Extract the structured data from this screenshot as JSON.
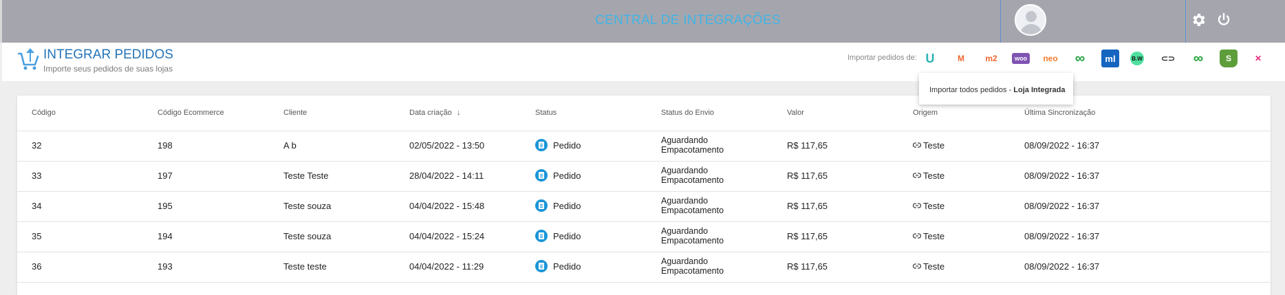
{
  "topbar": {
    "title": "CENTRAL DE INTEGRAÇÕES",
    "icons": [
      "avatar",
      "gear-icon",
      "power-icon"
    ]
  },
  "page": {
    "title": "INTEGRAR PEDIDOS",
    "subtitle": "Importe seus pedidos de suas lojas",
    "import_label": "Importar pedidos de:"
  },
  "stores": [
    {
      "name": "loja-integrada",
      "glyph": "U",
      "color": "#2bb5b0"
    },
    {
      "name": "magento",
      "glyph": "M",
      "color": "#ee672f"
    },
    {
      "name": "magento-2",
      "glyph": "m2",
      "color": "#ee672f"
    },
    {
      "name": "woocommerce",
      "glyph": "woo",
      "color": "#7f54b3"
    },
    {
      "name": "neo",
      "glyph": "neo",
      "color": "#f07b2c"
    },
    {
      "name": "tray",
      "glyph": "∞",
      "color": "#1fa339"
    },
    {
      "name": "mercado-livre",
      "glyph": "ml",
      "color": "#1565c0"
    },
    {
      "name": "bw",
      "glyph": "B.W",
      "color": "#1f8f44"
    },
    {
      "name": "link-store",
      "glyph": "⊂⊃",
      "color": "#333333"
    },
    {
      "name": "tray-2",
      "glyph": "∞",
      "color": "#1fa339"
    },
    {
      "name": "shopify",
      "glyph": "S",
      "color": "#5e9e3a"
    },
    {
      "name": "vtex-like",
      "glyph": "✕",
      "color": "#e6297a"
    }
  ],
  "tooltip": {
    "prefix": "Importar todos pedidos - ",
    "store": "Loja Integrada"
  },
  "table": {
    "columns": [
      "Código",
      "Código Ecommerce",
      "Cliente",
      "Data criação",
      "Status",
      "Status do Envio",
      "Valor",
      "Origem",
      "Última Sincronização"
    ],
    "sort_indicator": "↓",
    "rows": [
      {
        "codigo": "32",
        "ecommerce": "198",
        "cliente": "A b",
        "data": "02/05/2022 - 13:50",
        "status": "Pedido",
        "envio1": "Aguardando",
        "envio2": "Empacotamento",
        "valor": "R$ 117,65",
        "origem": "Teste",
        "sync": "08/09/2022 - 16:37"
      },
      {
        "codigo": "33",
        "ecommerce": "197",
        "cliente": "Teste Teste",
        "data": "28/04/2022 - 14:11",
        "status": "Pedido",
        "envio1": "Aguardando",
        "envio2": "Empacotamento",
        "valor": "R$ 117,65",
        "origem": "Teste",
        "sync": "08/09/2022 - 16:37"
      },
      {
        "codigo": "34",
        "ecommerce": "195",
        "cliente": "Teste souza",
        "data": "04/04/2022 - 15:48",
        "status": "Pedido",
        "envio1": "Aguardando",
        "envio2": "Empacotamento",
        "valor": "R$ 117,65",
        "origem": "Teste",
        "sync": "08/09/2022 - 16:37"
      },
      {
        "codigo": "35",
        "ecommerce": "194",
        "cliente": "Teste souza",
        "data": "04/04/2022 - 15:24",
        "status": "Pedido",
        "envio1": "Aguardando",
        "envio2": "Empacotamento",
        "valor": "R$ 117,65",
        "origem": "Teste",
        "sync": "08/09/2022 - 16:37"
      },
      {
        "codigo": "36",
        "ecommerce": "193",
        "cliente": "Teste teste",
        "data": "04/04/2022 - 11:29",
        "status": "Pedido",
        "envio1": "Aguardando",
        "envio2": "Empacotamento",
        "valor": "R$ 117,65",
        "origem": "Teste",
        "sync": "08/09/2022 - 16:37"
      }
    ]
  },
  "colors": {
    "topbar": "#a5a6ad",
    "accent": "#2474b8",
    "title": "#41b4e6",
    "status": "#1a96d8"
  }
}
